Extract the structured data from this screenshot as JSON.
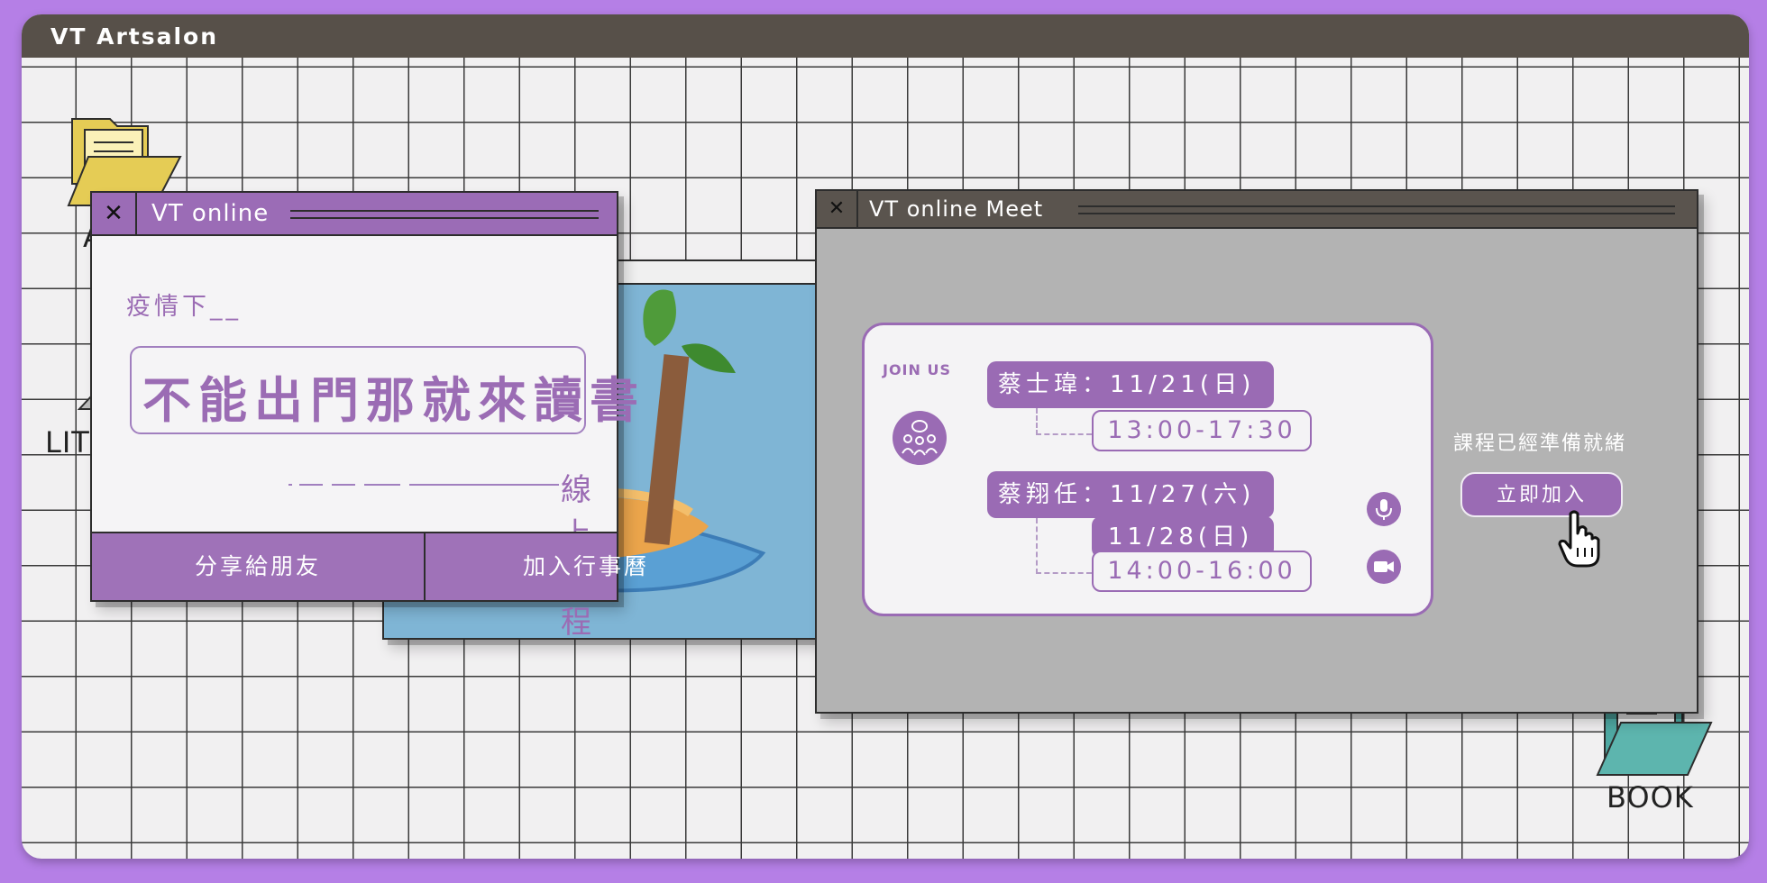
{
  "app": {
    "title": "VT Artsalon"
  },
  "desktop": {
    "icons": [
      {
        "label": "AR"
      },
      {
        "label": "LITE"
      },
      {
        "label": "BOOK"
      }
    ]
  },
  "online_window": {
    "title": "VT online",
    "close_glyph": "✕",
    "intro": "疫情下__",
    "headline": "不能出門那就來讀書",
    "subtitle": "線上課程",
    "buttons": {
      "share": "分享給朋友",
      "calendar": "加入行事曆"
    }
  },
  "meet_window": {
    "title": "VT online Meet",
    "close_glyph": "✕",
    "join_label": "JOIN US",
    "sessions": [
      {
        "speaker_dates": "蔡士瑋：11/21(日)",
        "time": "13:00-17:30"
      },
      {
        "speaker_dates": "蔡翔任：11/27(六)",
        "extra_date": "11/28(日)",
        "time": "14:00-16:00"
      }
    ],
    "ready_text": "課程已經準備就緒",
    "join_button": "立即加入"
  },
  "colors": {
    "accent": "#9a6bb4",
    "titlebar": "#575049",
    "background": "#b57fe6",
    "meet_bg": "#b3b3b3"
  },
  "icons": [
    "folder-icon",
    "image-file-icon",
    "group-chat-icon",
    "microphone-icon",
    "video-camera-icon",
    "hand-pointer-icon",
    "close-icon"
  ]
}
